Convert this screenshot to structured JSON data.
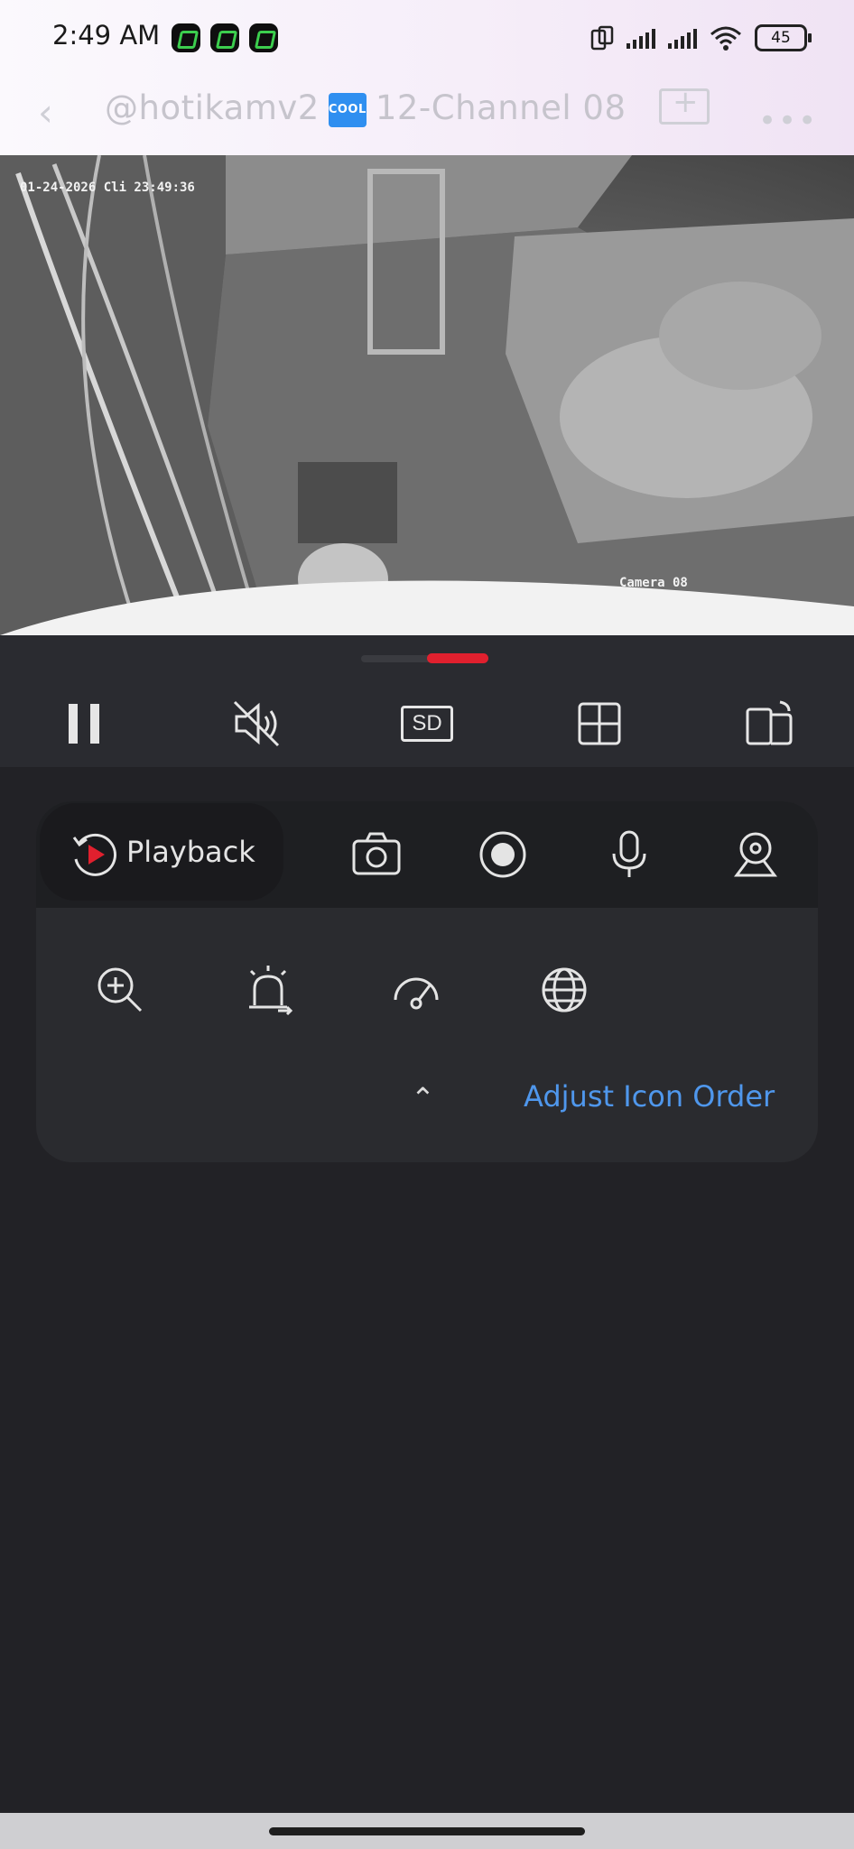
{
  "status_bar": {
    "time": "2:49 AM",
    "battery": "45"
  },
  "header": {
    "title_prefix": "@hotikamv2",
    "badge": "COOL",
    "title_suffix": "12-Channel 08"
  },
  "video": {
    "timestamp": "01-24-2026 Cli 23:49:36",
    "camera_label": "Camera 08"
  },
  "controls": {
    "quality": "SD"
  },
  "tools": {
    "playback_label": "Playback",
    "adjust_label": "Adjust Icon Order"
  },
  "colors": {
    "accent_red": "#e0202e",
    "link_blue": "#4f97ec",
    "panel_bg": "#2a2b2f",
    "page_bg": "#222226"
  }
}
